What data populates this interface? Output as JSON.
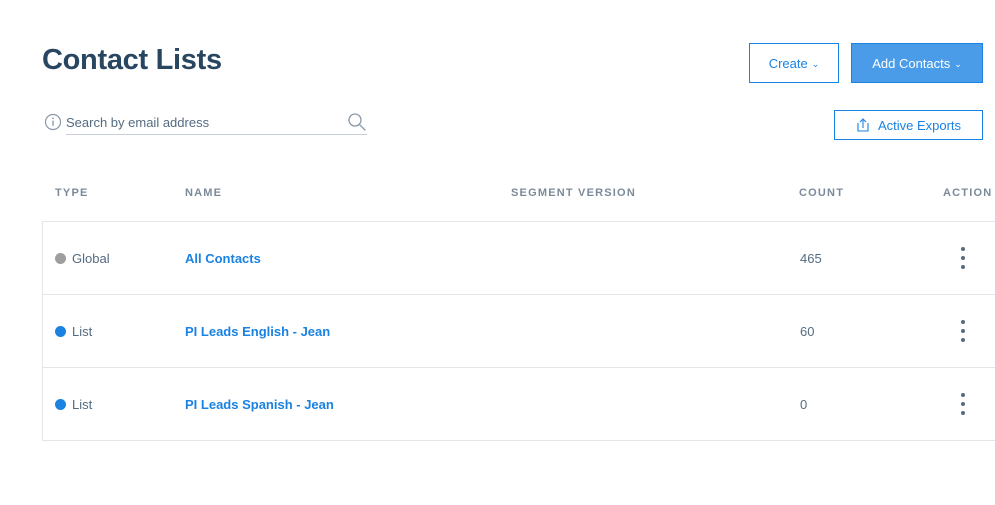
{
  "page": {
    "title": "Contact Lists"
  },
  "toolbar": {
    "create_label": "Create",
    "add_contacts_label": "Add Contacts",
    "active_exports_label": "Active Exports",
    "chevron": "⌄"
  },
  "search": {
    "placeholder": "Search by email address",
    "value": ""
  },
  "table": {
    "headers": {
      "type": "TYPE",
      "name": "NAME",
      "segment_version": "SEGMENT VERSION",
      "count": "COUNT",
      "action": "ACTION"
    },
    "rows": [
      {
        "type": "Global",
        "type_color": "#9e9e9e",
        "name": "All Contacts",
        "segment_version": "",
        "count": "465"
      },
      {
        "type": "List",
        "type_color": "#1a82e2",
        "name": "PI Leads English - Jean",
        "segment_version": "",
        "count": "60"
      },
      {
        "type": "List",
        "type_color": "#1a82e2",
        "name": "PI Leads Spanish - Jean",
        "segment_version": "",
        "count": "0"
      }
    ]
  },
  "colors": {
    "accent": "#1a82e2",
    "title": "#294661",
    "header_text": "#7b8a99"
  },
  "icons": {
    "info": "info-icon",
    "search": "search-icon",
    "export": "export-icon",
    "kebab": "more-vertical-icon"
  }
}
